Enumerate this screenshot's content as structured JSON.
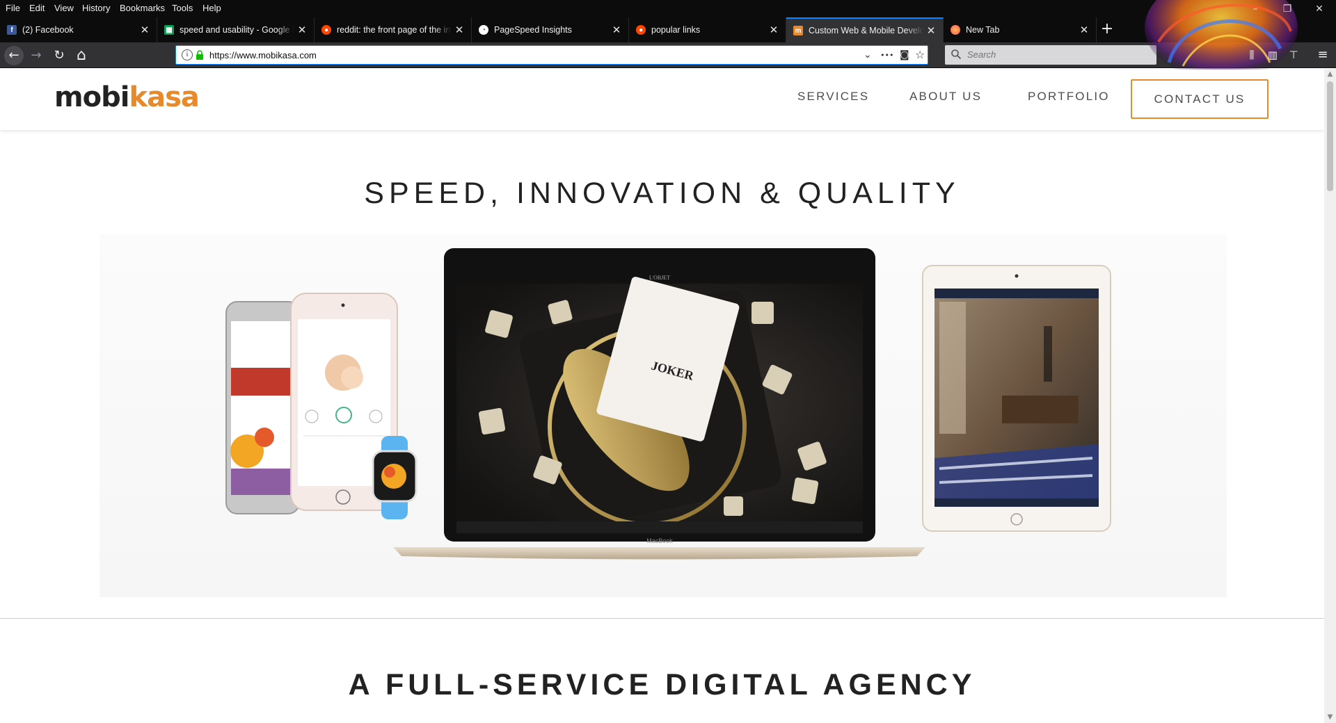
{
  "menubar": {
    "items": [
      {
        "label": "File"
      },
      {
        "label": "Edit"
      },
      {
        "label": "View"
      },
      {
        "label": "History"
      },
      {
        "label": "Bookmarks"
      },
      {
        "label": "Tools"
      },
      {
        "label": "Help"
      }
    ]
  },
  "window_controls": {
    "minimize": "–",
    "restore": "❐",
    "close": "✕"
  },
  "tabs": [
    {
      "title": "(2) Facebook",
      "icon": "facebook-icon",
      "icon_color": "#3b5998",
      "active": false
    },
    {
      "title": "speed and usability - Google Sheets",
      "icon": "google-sheets-icon",
      "icon_color": "#0f9d58",
      "active": false
    },
    {
      "title": "reddit: the front page of the internet",
      "icon": "reddit-icon",
      "icon_color": "#ff4500",
      "active": false
    },
    {
      "title": "PageSpeed Insights",
      "icon": "pagespeed-icon",
      "icon_color": "#888888",
      "active": false
    },
    {
      "title": "popular links",
      "icon": "reddit-icon",
      "icon_color": "#ff4500",
      "active": false
    },
    {
      "title": "Custom Web & Mobile Development",
      "icon": "mobikasa-icon",
      "icon_color": "#e8892b",
      "active": true
    },
    {
      "title": "New Tab",
      "icon": "firefox-icon",
      "icon_color": "#ff7139",
      "active": false
    }
  ],
  "tab_close_glyph": "✕",
  "new_tab_glyph": "+",
  "navbar": {
    "url": "https://www.mobikasa.com",
    "search_placeholder": "Search",
    "back_glyph": "←",
    "forward_glyph": "→",
    "reload_glyph": "↻",
    "home_glyph": "⌂",
    "dropdown_glyph": "⌄",
    "more_glyph": "•••",
    "pocket_glyph": "◙",
    "bookmark_glyph": "☆",
    "library_glyph": "⫼",
    "sidebar_glyph": "▥",
    "sync_glyph": "⊤",
    "menu_glyph": "≡"
  },
  "site": {
    "logo_part1": "mobi",
    "logo_part2": "kasa",
    "nav": [
      {
        "label": "SERVICES"
      },
      {
        "label": "ABOUT US"
      },
      {
        "label": "PORTFOLIO"
      }
    ],
    "contact_label": "CONTACT US",
    "headline": "SPEED, INNOVATION & QUALITY",
    "subheadline": "A FULL-SERVICE DIGITAL AGENCY",
    "laptop_label": "MacBook",
    "accent_color": "#e8892b"
  }
}
